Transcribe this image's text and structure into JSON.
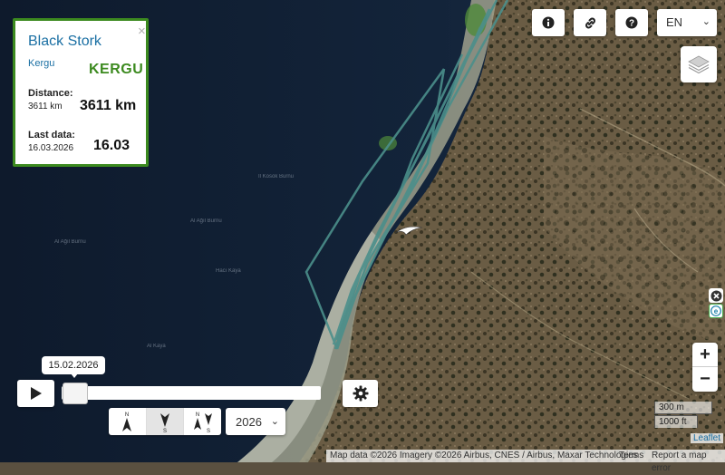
{
  "info_card": {
    "title": "Black Stork",
    "name_link": "Kergu",
    "brand": "KERGU",
    "distance_label": "Distance:",
    "distance_value": "3611 km",
    "distance_big": "3611 km",
    "last_data_label": "Last data:",
    "last_data_value": "16.03.2026",
    "last_data_big": "16.03",
    "close_glyph": "×",
    "accent_color": "#3c8a1f"
  },
  "toolbar": {
    "info_icon": "info-icon",
    "link_icon": "link-icon",
    "help_icon": "help-icon",
    "language": "EN",
    "layers_icon": "layers-icon"
  },
  "side_buttons": {
    "close_icon": "close-circle-icon",
    "e_icon": "e-icon"
  },
  "zoom": {
    "in": "+",
    "out": "−"
  },
  "scale": {
    "metric": "300 m",
    "imperial": "1000 ft"
  },
  "attribution": {
    "leaflet": "Leaflet",
    "map_data": "Map data ©2026 Imagery ©2026 Airbus, CNES / Airbus, Maxar Technologies",
    "terms": "Terms",
    "report": "Report a map error"
  },
  "timeline": {
    "tooltip_date": "15.02.2026",
    "year": "2026",
    "progress": 0.0,
    "direction_modes": [
      "north",
      "south",
      "north-south"
    ],
    "direction_active": "south"
  },
  "direction_labels": {
    "north": "N",
    "south": "S",
    "both_n": "N",
    "both_s": "S"
  },
  "map_labels": {
    "a": "Il Kosok Burnu",
    "b": "Al Ağıl Burnu",
    "c": "Al Ağıl Burnu",
    "d": "Hacı Kaya",
    "e": "Al Kaya"
  },
  "track_color": "#4b8f8b"
}
